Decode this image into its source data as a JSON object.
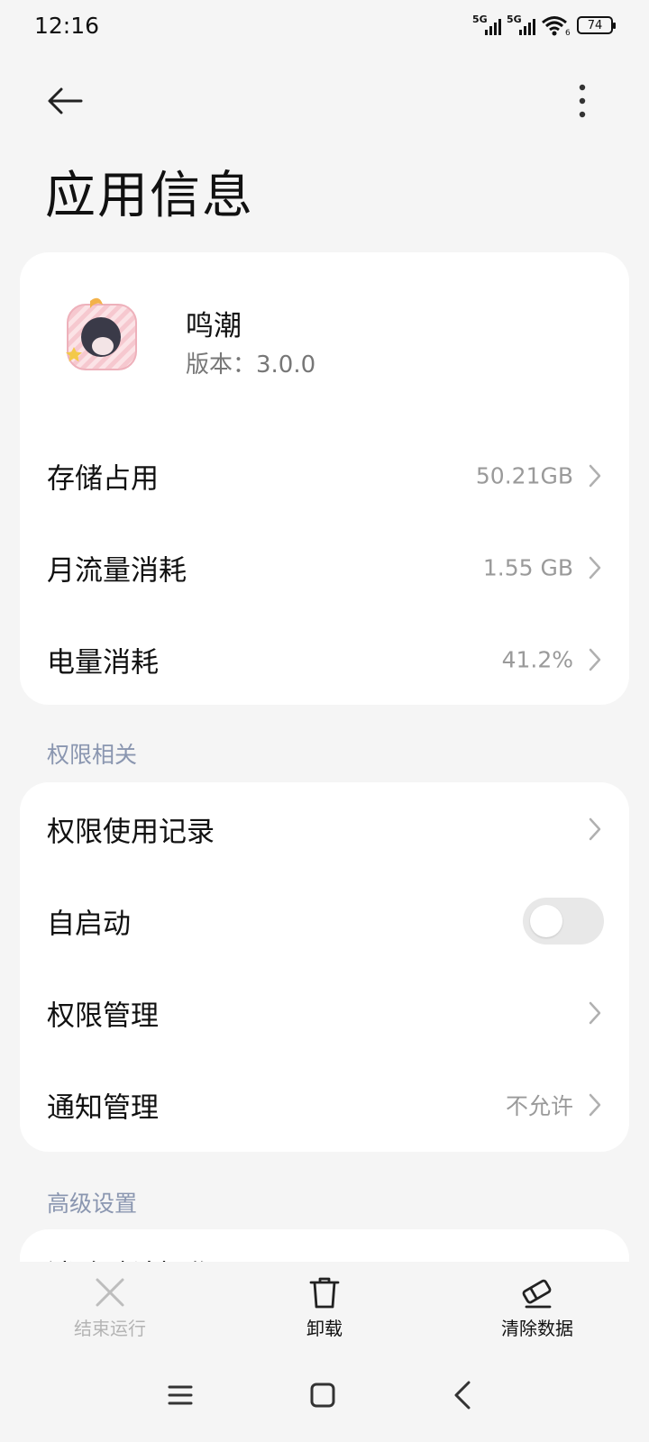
{
  "status_bar": {
    "time": "12:16",
    "signal_label_1": "5G",
    "signal_label_2": "5G",
    "wifi_label": "6",
    "battery": "74"
  },
  "header": {
    "title": "应用信息"
  },
  "app": {
    "name": "鸣潮",
    "version": "版本：3.0.0"
  },
  "usage_rows": [
    {
      "label": "存储占用",
      "value": "50.21GB"
    },
    {
      "label": "月流量消耗",
      "value": "1.55 GB"
    },
    {
      "label": "电量消耗",
      "value": "41.2%"
    }
  ],
  "permissions": {
    "section_title": "权限相关",
    "rows": [
      {
        "label": "权限使用记录"
      },
      {
        "label": "自启动",
        "toggle": false
      },
      {
        "label": "权限管理"
      },
      {
        "label": "通知管理",
        "value": "不允许"
      }
    ]
  },
  "advanced": {
    "section_title": "高级设置",
    "first_row_label": "消除默认操作"
  },
  "actions": {
    "force_stop": "结束运行",
    "uninstall": "卸载",
    "clear_data": "清除数据"
  },
  "colors": {
    "background": "#f5f5f5",
    "card": "#ffffff",
    "section_header": "#8a96b0",
    "secondary_text": "#9a9a9a"
  }
}
